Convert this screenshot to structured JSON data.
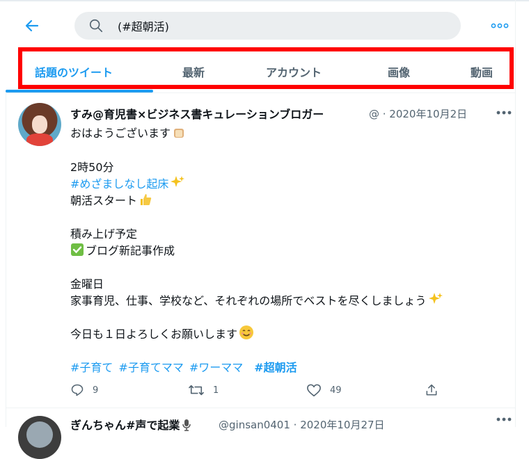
{
  "search": {
    "value": "(#超朝活)"
  },
  "tabs": [
    {
      "label": "話題のツイート",
      "active": true
    },
    {
      "label": "最新",
      "active": false
    },
    {
      "label": "アカウント",
      "active": false
    },
    {
      "label": "画像",
      "active": false
    },
    {
      "label": "動画",
      "active": false
    }
  ],
  "tweet": {
    "display_name": "すみ@育児書×ビジネス書キュレーションブロガー",
    "meta": "@ · 2020年10月2日",
    "lines": [
      "おはようございます",
      "2時50分",
      "#めざましなし起床",
      "朝活スタート",
      "積み上げ予定",
      "ブログ新記事作成",
      "金曜日",
      "家事育児、仕事、学校など、それぞれの場所でベストを尽くしましょう",
      "今日も１日よろしくお願いします"
    ],
    "hashtags": [
      "#子育て",
      "#子育てママ",
      "#ワーママ",
      "#超朝活"
    ],
    "reply_count": "9",
    "retweet_count": "1",
    "like_count": "49"
  },
  "next_tweet": {
    "display_name": "ぎんちゃん#声で起業",
    "meta": "@ginsan0401 · 2020年10月27日"
  },
  "colors": {
    "accent": "#1d9bf0",
    "highlight_border": "#ff0000",
    "search_bg": "#ebeef0"
  }
}
